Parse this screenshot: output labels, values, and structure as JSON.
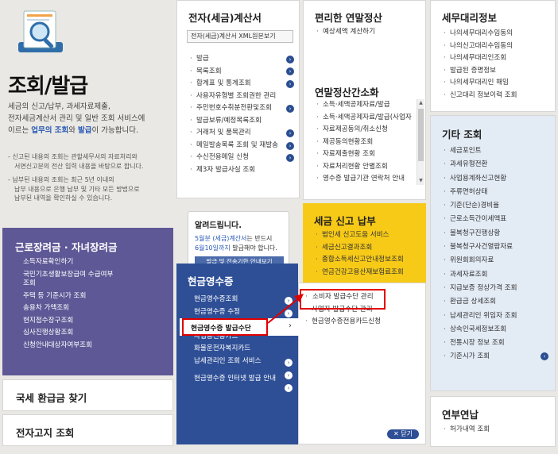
{
  "left": {
    "title": "조회/발급",
    "desc": [
      "세금의 신고/납부, 과세자료제출,",
      "전자세금계산서 관리 및 일반 조회 서비스에",
      "이르는 ",
      "업무의 조회",
      "와 ",
      "발급",
      "이 가능합니다."
    ],
    "notes": [
      [
        "신고된 내용의 조회는 관할세무서의 자료처리와",
        "서면신고분의 전산 입력 내용을 바탕으로 합니다."
      ],
      [
        "납부된 내용의 조회는 최근 5년 이내의",
        "납부 내용으로 은행 납부 및 기타 모든 방법으로",
        "납부된 내역을 확인하실 수 있습니다."
      ]
    ]
  },
  "labor": {
    "title": "근로장려금 · 자녀장려금",
    "items": [
      "소득자료확인하기",
      "국민기초생활보장급여 수급여부",
      "조회",
      "주택 등 기준시가 조회",
      "송용차 가액조회",
      "현지점수장구조회",
      "심사진행상황조회",
      "신청안내대상자여부조회"
    ]
  },
  "refund": {
    "title": "국세 환급금 찾기"
  },
  "notice": {
    "title": "전자고지 조회"
  },
  "einvoice": {
    "title": "전자(세금)계산서",
    "select": "전자(세금)계산서 XML원본보기",
    "items": [
      "발급",
      "목록조회",
      "합계표 및 통계조회",
      "사용자유형별 조회권한 관리",
      "주민번호수취분전환및조회",
      "발급보류/예정목록조회",
      "거래처 및 품목관리",
      "메일발송목록 조회 및 재발송",
      "수신전용메일 신청",
      "제3자 발급사실 조회"
    ]
  },
  "alert": {
    "title": "알려드립니다.",
    "line1a": "5월분 (세금)계산서",
    "line1b": "는 반드시",
    "line2a": "6월10일까지",
    "line2b": " 발급해야 합니다.",
    "button": "발급 및 전송기한 안내보기"
  },
  "yearend": {
    "title": "편리한 연말정산",
    "items": [
      "예상세액 계산하기"
    ]
  },
  "simplify": {
    "title": "연말정산간소화",
    "items": [
      "소득·세액공제자료/발급",
      "소득·세액공제자료/발급(사업자)",
      "자료제공동의/취소신청",
      "제공동의현황조회",
      "자료제출현황 조회",
      "자료처리현황 안별조회",
      "영수증 발급기관 연락처 안내"
    ]
  },
  "tax_report": {
    "title": "세금 신고 납부",
    "items": [
      "법인세 신고도움 서비스",
      "세금신고결과조회",
      "종합소득세신고안내정보조회",
      "연금건강고용산재보험료조회"
    ]
  },
  "cash": {
    "title": "현금영수증",
    "items": [
      "현금영수증조회",
      "현금영수증 수정",
      "현금영수증 발급수단",
      "사업용신용카드",
      "화물운전자복지카드",
      "납세관리인 조회 서비스",
      "현금영수증 인터넷 발급 안내"
    ]
  },
  "submenu": {
    "items": [
      "소비자 발급수단 관리",
      "사업자 발급수단 관리",
      "현금영수증전용카드신청"
    ],
    "close": "닫기"
  },
  "agent": {
    "title": "세무대리정보",
    "items": [
      "나의세무대리수임동의",
      "나의신고대리수임동의",
      "나의세무대리인조회",
      "발급된 증명정보",
      "나의세무대리인 해임",
      "신고대리 정보이력 조회"
    ]
  },
  "other": {
    "title": "기타 조회",
    "items": [
      "세금포인트",
      "과세유형전환",
      "사업용계좌신고현황",
      "주류면허상태",
      "기준(단순)경비율",
      "근로소득간이세액표",
      "불복청구진행상황",
      "불복청구사건열람자료",
      "위원회회의자료",
      "과세자료조회",
      "지급보증 정상가격 조회",
      "환급금 상세조회",
      "납세관리인 위임자 조회",
      "상속인국세정보조회",
      "전통시장 정보 조회",
      "기준시가 조회"
    ]
  },
  "annual": {
    "title": "연부연납",
    "items": [
      "허가내역 조회"
    ]
  },
  "colors": {
    "navy": "#2e4f96",
    "purple": "#5e5896",
    "yellow": "#f7ca18",
    "red": "#e00000",
    "link": "#2a59b5"
  }
}
